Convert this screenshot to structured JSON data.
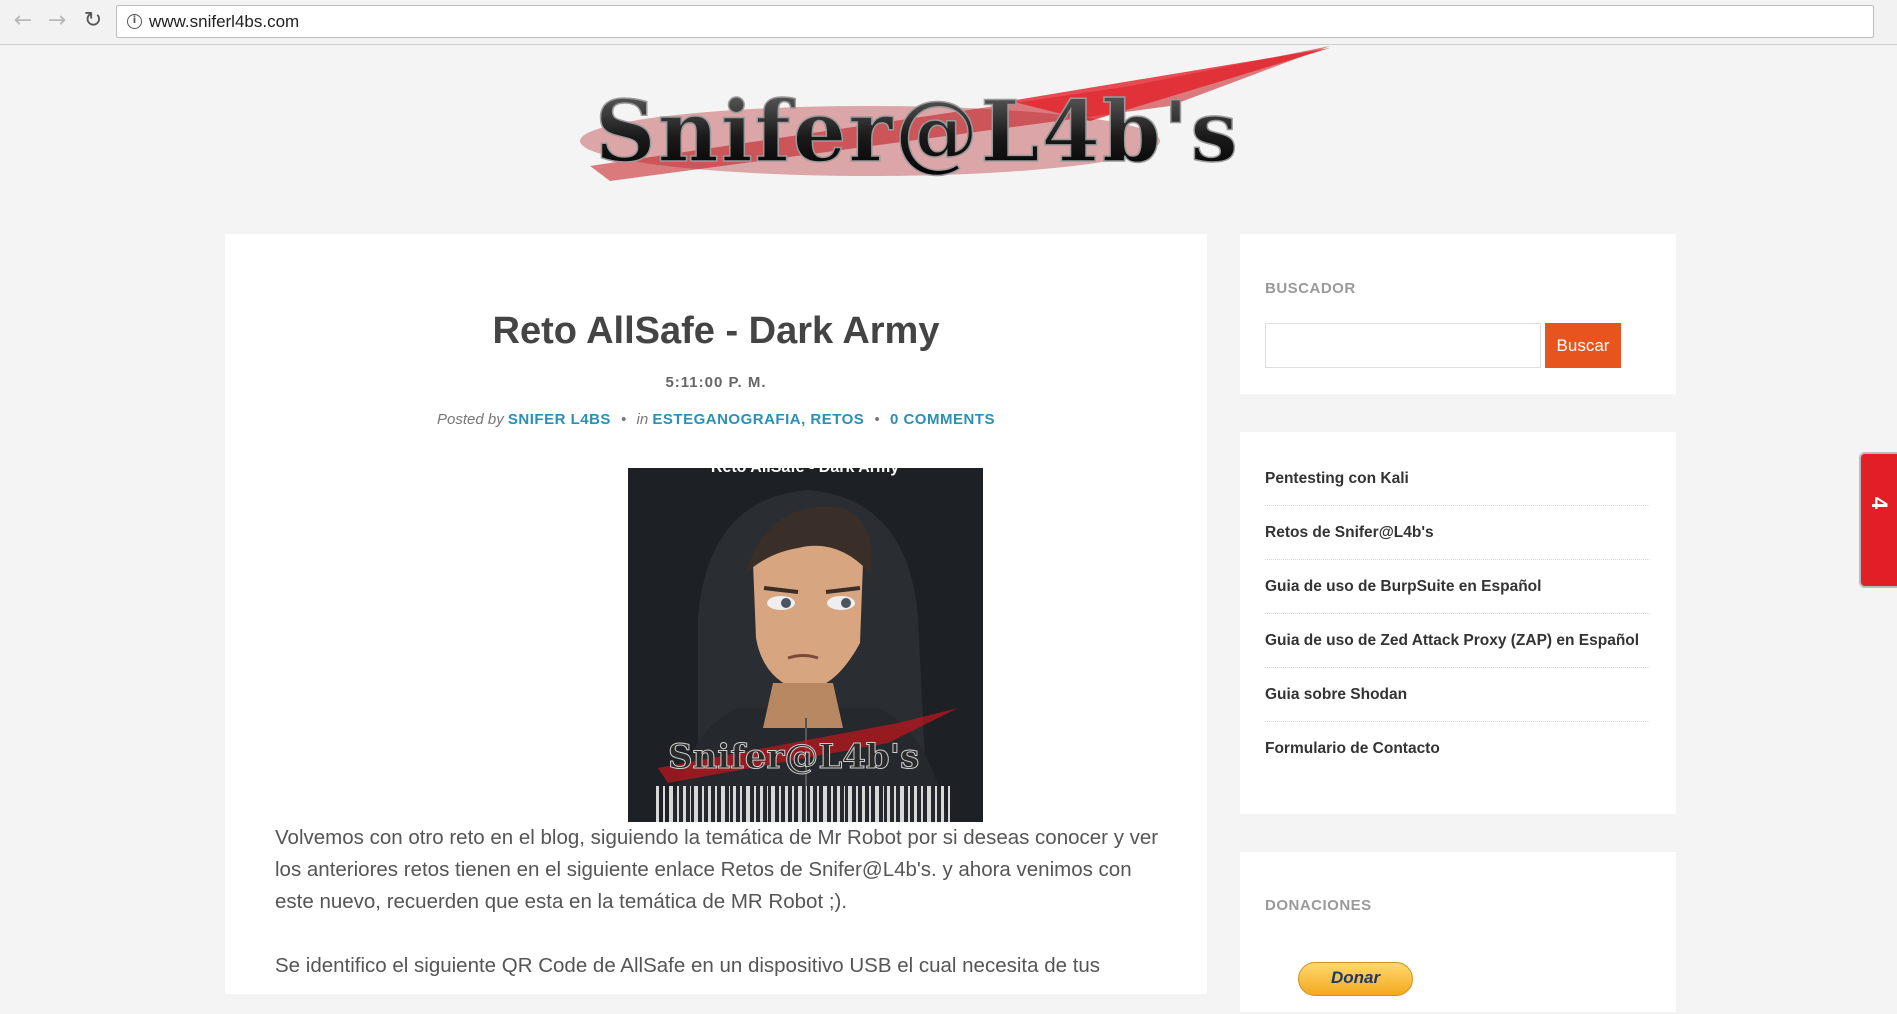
{
  "browser": {
    "back_icon": "arrow-left-icon",
    "forward_icon": "arrow-right-icon",
    "reload_icon": "reload-icon",
    "url": "www.sniferl4bs.com"
  },
  "logo": {
    "text": "Snifer@L4b's"
  },
  "post": {
    "title": "Reto AllSafe - Dark Army",
    "time": "5:11:00 P. M.",
    "posted_by_label": "Posted by",
    "author": "SNIFER L4BS",
    "in_label": "in",
    "categories": "ESTEGANOGRAFIA, RETOS",
    "comments": "0 COMMENTS",
    "image": {
      "caption_top": "Reto AllSafe - Dark Army",
      "logo_text": "Snifer@L4b's"
    },
    "paragraphs": [
      "Volvemos con otro reto en el blog, siguiendo la temática de Mr Robot por si deseas conocer y ver los anteriores retos tienen en el siguiente enlace Retos de Snifer@L4b's. y ahora venimos con este nuevo, recuerden que esta en la temática de MR Robot ;).",
      "Se identifico el siguiente QR Code de AllSafe en un dispositivo USB el cual necesita de tus"
    ]
  },
  "sidebar": {
    "search": {
      "title": "BUSCADOR",
      "placeholder": "",
      "button": "Buscar"
    },
    "pages": [
      "Pentesting con Kali",
      "Retos de Snifer@L4b's",
      "Guia de uso de BurpSuite en Español",
      "Guia de uso de Zed Attack Proxy (ZAP) en Español",
      "Guia sobre Shodan",
      "Formulario de Contacto"
    ],
    "donations": {
      "title": "DONACIONES",
      "button": "Donar"
    }
  },
  "side_tab": {
    "glyph": "4"
  },
  "colors": {
    "accent": "#e8541e",
    "link": "#2b8fb6",
    "logo_red": "#c4161c"
  }
}
